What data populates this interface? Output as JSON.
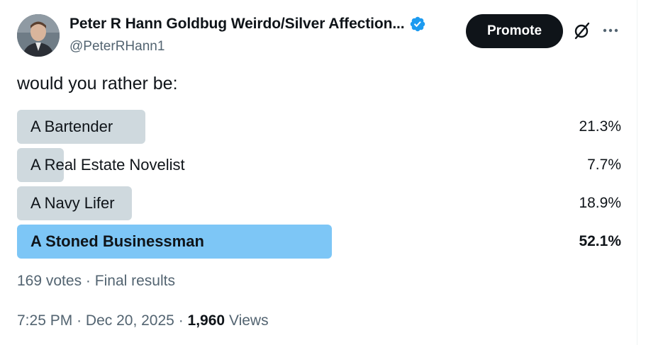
{
  "author": {
    "display_name": "Peter R Hann Goldbug Weirdo/Silver Affection...",
    "handle": "@PeterRHann1"
  },
  "actions": {
    "promote_label": "Promote"
  },
  "tweet": {
    "text": "would you rather be:"
  },
  "poll": {
    "options": [
      {
        "label": "A Bartender",
        "percent_text": "21.3%",
        "percent": 21.3
      },
      {
        "label": "A Real Estate Novelist",
        "percent_text": "7.7%",
        "percent": 7.7
      },
      {
        "label": "A Navy Lifer",
        "percent_text": "18.9%",
        "percent": 18.9
      },
      {
        "label": "A Stoned Businessman",
        "percent_text": "52.1%",
        "percent": 52.1
      }
    ],
    "votes": "169 votes",
    "separator": "·",
    "status": "Final results"
  },
  "meta": {
    "time": "7:25 PM",
    "sep1": "·",
    "date": "Dec 20, 2025",
    "sep2": "·",
    "views_count": "1,960",
    "views_label": "Views"
  },
  "colors": {
    "bar": "#cfd9de",
    "winner_bar": "#7dc6f6",
    "verified": "#1d9bf0",
    "promote_bg": "#0f1419"
  }
}
